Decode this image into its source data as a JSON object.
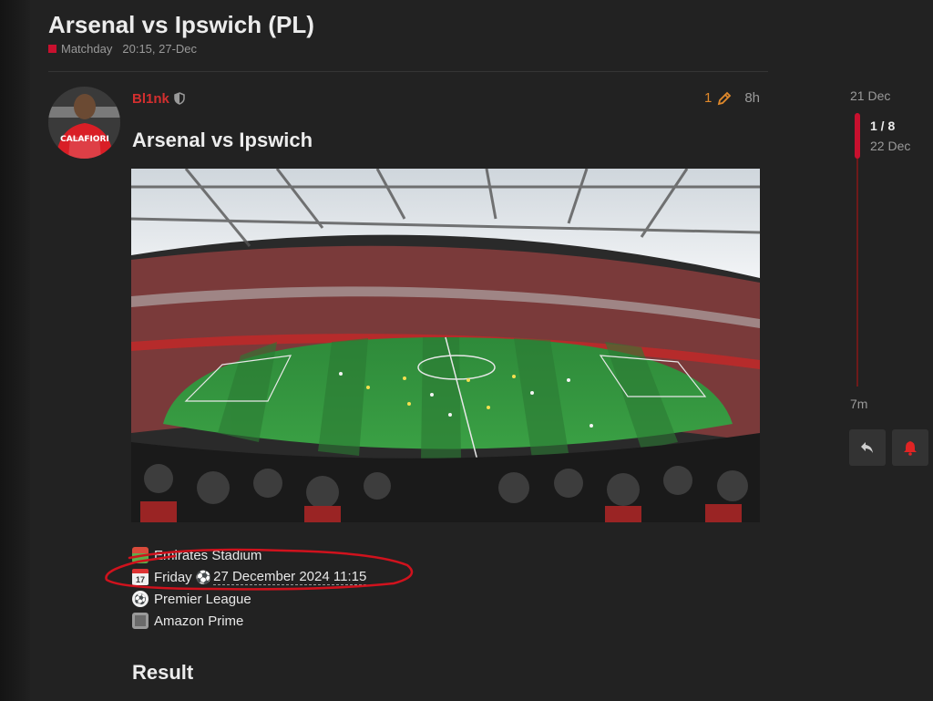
{
  "topic": {
    "title": "Arsenal vs Ipswich (PL)",
    "category": "Matchday",
    "category_color": "#c8102e",
    "created": "20:15, 27-Dec"
  },
  "post": {
    "username": "Bl1nk",
    "username_color": "#d32f2f",
    "avatar_text": "CALAFIORI",
    "edit_count": "1",
    "age": "8h",
    "heading": "Arsenal vs Ipswich",
    "info": {
      "venue": "Emirates Stadium",
      "day": "Friday",
      "date": "27 December 2024 11:15",
      "competition": "Premier League",
      "broadcaster": "Amazon Prime"
    },
    "result_heading": "Result"
  },
  "timeline": {
    "start_date": "21 Dec",
    "position": "1 / 8",
    "position_date": "22 Dec",
    "end_age": "7m"
  },
  "icons": {
    "shield": "shield-icon",
    "pencil": "pencil-icon",
    "reply": "reply-icon",
    "bell": "bell-icon"
  },
  "colors": {
    "accent": "#c8102e",
    "edit": "#e0892b",
    "annotation": "#d0121d"
  }
}
